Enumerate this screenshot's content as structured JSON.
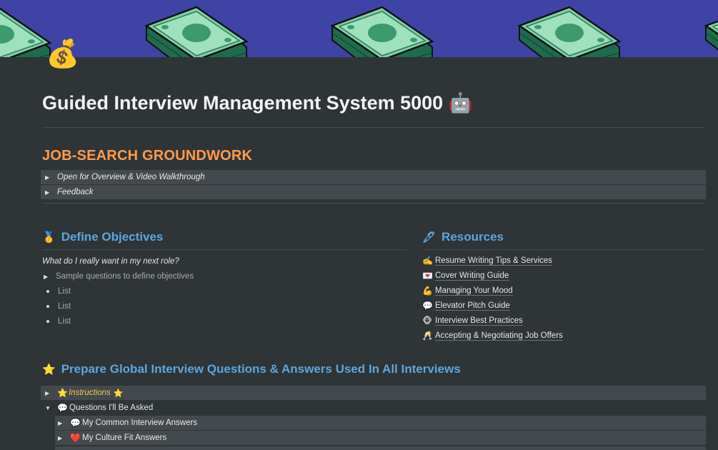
{
  "page": {
    "title": "Guided Interview Management System 5000 🤖",
    "icon": "💰",
    "cover_color": "#3f43a6"
  },
  "groundwork": {
    "heading": "JOB-SEARCH GROUNDWORK",
    "toggles": [
      {
        "label": "Open for Overview & Video Walkthrough"
      },
      {
        "label": "Feedback"
      }
    ]
  },
  "objectives": {
    "emoji": "🥇",
    "heading": "Define Objectives",
    "question": "What do I really want in my next role?",
    "toggle_label": "Sample questions to define objectives",
    "bullets": [
      "List",
      "List",
      "List"
    ]
  },
  "resources": {
    "emoji": "🖋",
    "heading": "Resources",
    "links": [
      {
        "emoji": "✍️",
        "label": "Resume Writing Tips & Services"
      },
      {
        "emoji": "💌",
        "label": "Cover Writing Guide"
      },
      {
        "emoji": "💪",
        "label": "Managing Your Mood"
      },
      {
        "emoji": "💬",
        "label": "Elevator Pitch Guide"
      },
      {
        "emoji": "🐵",
        "label": "Interview Best Practices"
      },
      {
        "emoji": "🥂",
        "label": "Accepting & Negotiating Job Offers"
      }
    ]
  },
  "global_questions": {
    "emoji": "⭐",
    "heading": "Prepare Global Interview Questions & Answers Used In All Interviews",
    "instructions": {
      "emoji": "⭐",
      "label": "Instructions",
      "trail_emoji": "⭐"
    },
    "questions": {
      "emoji": "💬",
      "label": "Questions I'll Be Asked"
    },
    "sub_toggles": [
      {
        "emoji": "💬",
        "label": "My Common Interview Answers"
      },
      {
        "emoji": "❤️",
        "label": "My Culture Fit Answers"
      }
    ]
  },
  "colors": {
    "background": "#2f3437",
    "toggle_bg": "#44494d",
    "section_orange": "#ff9a4b",
    "heading_blue": "#5aa7e0",
    "instructions_yellow": "#f2c94c"
  }
}
